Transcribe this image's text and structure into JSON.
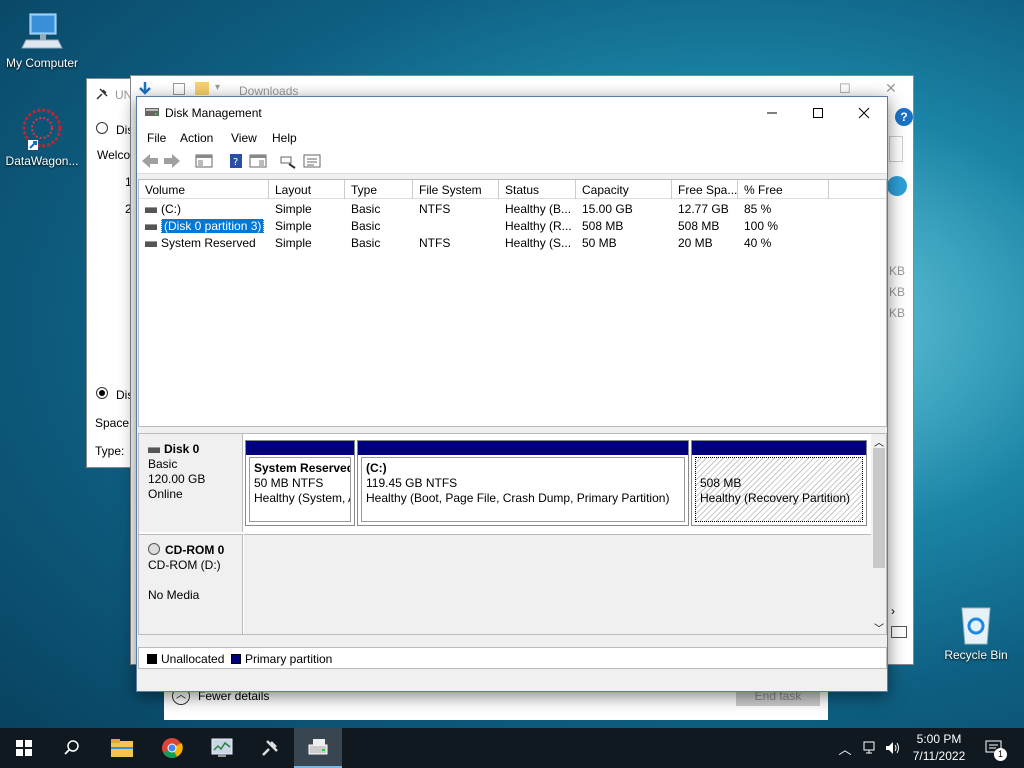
{
  "desktop": {
    "my_computer": "My Computer",
    "datawagon": "DataWagon...",
    "recycle_bin": "Recycle Bin"
  },
  "bg_left_window": {
    "title": "UN",
    "radio1": "Dis",
    "welcome": "Welco",
    "line1": "1",
    "line2": "2",
    "radio2": "Dis",
    "space": "Space u",
    "type": "Type:"
  },
  "bg_explorer": {
    "title": "Downloads",
    "sizes": [
      "KB",
      "KB",
      "KB"
    ]
  },
  "bg_taskmgr": {
    "fewer_details": "Fewer details",
    "end_task": "End task"
  },
  "disk_mgmt": {
    "title": "Disk Management",
    "menu": [
      "File",
      "Action",
      "View",
      "Help"
    ],
    "columns": [
      "Volume",
      "Layout",
      "Type",
      "File System",
      "Status",
      "Capacity",
      "Free Spa...",
      "% Free"
    ],
    "rows": [
      {
        "volume": "(C:)",
        "layout": "Simple",
        "type": "Basic",
        "fs": "NTFS",
        "status": "Healthy (B...",
        "capacity": "15.00 GB",
        "free": "12.77 GB",
        "pct": "85 %"
      },
      {
        "volume": "(Disk 0 partition 3)",
        "layout": "Simple",
        "type": "Basic",
        "fs": "",
        "status": "Healthy (R...",
        "capacity": "508 MB",
        "free": "508 MB",
        "pct": "100 %"
      },
      {
        "volume": "System Reserved",
        "layout": "Simple",
        "type": "Basic",
        "fs": "NTFS",
        "status": "Healthy (S...",
        "capacity": "50 MB",
        "free": "20 MB",
        "pct": "40 %"
      }
    ],
    "disk0": {
      "name": "Disk 0",
      "type": "Basic",
      "size": "120.00 GB",
      "state": "Online",
      "partitions": [
        {
          "name": "System Reserved",
          "size": "50 MB NTFS",
          "status": "Healthy (System, A"
        },
        {
          "name": "(C:)",
          "size": "119.45 GB NTFS",
          "status": "Healthy (Boot, Page File, Crash Dump, Primary Partition)"
        },
        {
          "name": "",
          "size": "508 MB",
          "status": "Healthy (Recovery Partition)"
        }
      ]
    },
    "cdrom0": {
      "name": "CD-ROM 0",
      "drive": "CD-ROM (D:)",
      "media": "No Media"
    },
    "legend": {
      "unallocated": "Unallocated",
      "primary": "Primary partition"
    }
  },
  "taskbar": {
    "time": "5:00 PM",
    "date": "7/11/2022",
    "notifications": "1"
  },
  "colors": {
    "primary_partition": "#00007f",
    "unallocated": "#000000",
    "selection": "#0078d7"
  }
}
